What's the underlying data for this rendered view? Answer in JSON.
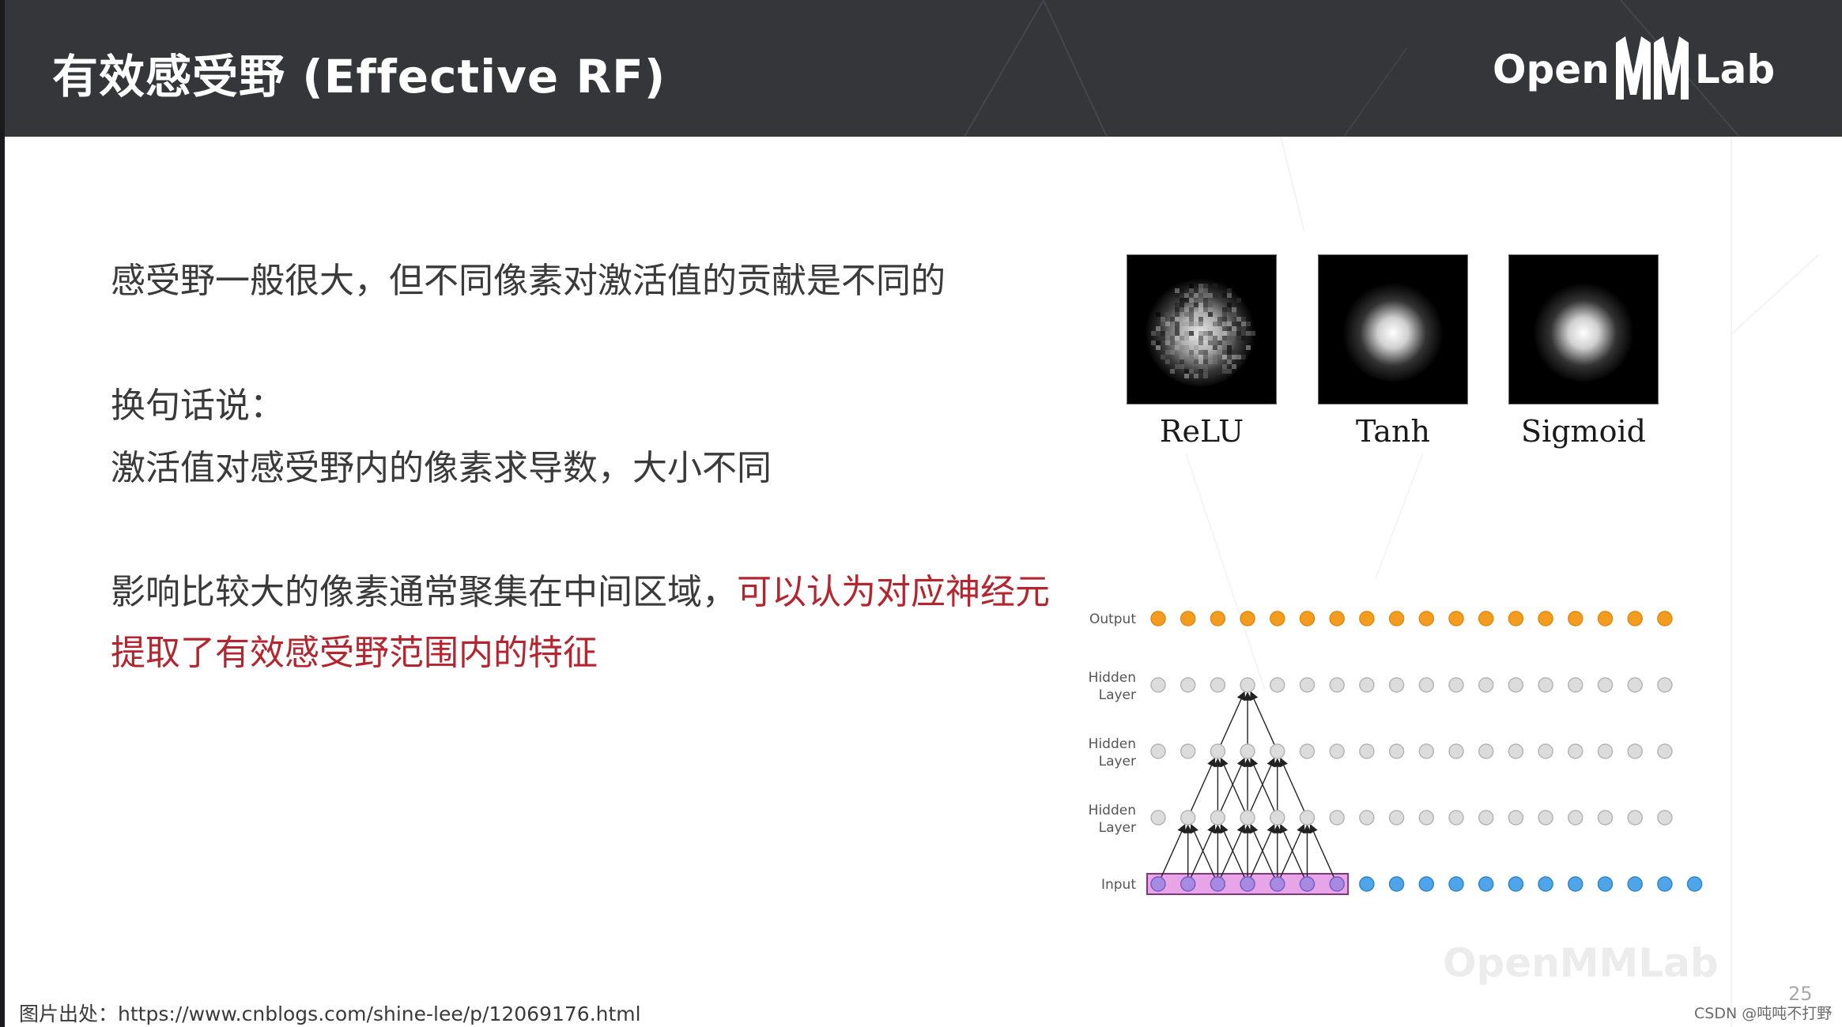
{
  "header": {
    "title": "有效感受野 (Effective RF)",
    "logo_open": "Open",
    "logo_lab": "Lab"
  },
  "body": {
    "line1": "感受野一般很大，但不同像素对激活值的贡献是不同的",
    "line2": "换句话说：",
    "line3": "激活值对感受野内的像素求导数，大小不同",
    "line4_black": "影响比较大的像素通常聚集在中间区域，",
    "line4_red": "可以认为对应神经元",
    "line5_red": "提取了有效感受野范围内的特征"
  },
  "figure": {
    "thumbnails": [
      {
        "label": "ReLU"
      },
      {
        "label": "Tanh"
      },
      {
        "label": "Sigmoid"
      }
    ],
    "network": {
      "layers": [
        {
          "label_line1": "Output",
          "label_line2": ""
        },
        {
          "label_line1": "Hidden",
          "label_line2": "Layer"
        },
        {
          "label_line1": "Hidden",
          "label_line2": "Layer"
        },
        {
          "label_line1": "Hidden",
          "label_line2": "Layer"
        },
        {
          "label_line1": "Input",
          "label_line2": ""
        }
      ],
      "output_color": "#f39c1f",
      "hidden_color": "#dcdcdc",
      "input_color": "#4fa5e8",
      "input_highlight_color": "#a78be0",
      "highlight_box_color": "#e7a5e8"
    }
  },
  "footer": {
    "source": "图片出处：https://www.cnblogs.com/shine-lee/p/12069176.html",
    "page_number": "25",
    "csdn": "CSDN @吨吨不打野",
    "watermark": "OpenMMLab"
  },
  "colors": {
    "header_bg": "#35363a",
    "red_text": "#b3262f",
    "body_text": "#3a3a3a"
  }
}
